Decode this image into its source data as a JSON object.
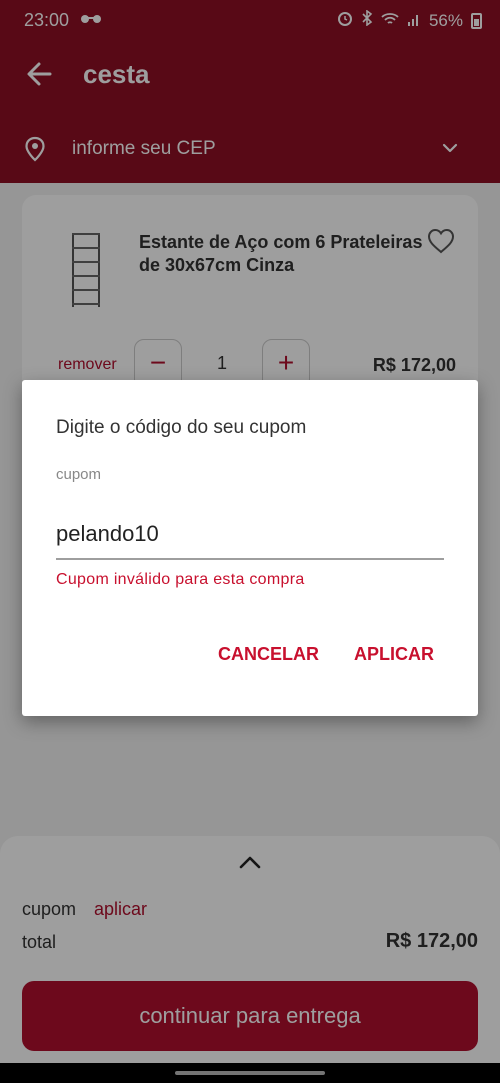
{
  "status_bar": {
    "time": "23:00",
    "glasses_icon": "glasses-icon",
    "icons": [
      "alarm-icon",
      "bluetooth-icon",
      "wifi-icon",
      "signal-icon"
    ],
    "battery": "56%",
    "battery_level": 0.56
  },
  "header": {
    "title": "cesta",
    "location_placeholder": "informe seu CEP",
    "icons": [
      "back-arrow-icon",
      "location-pin-icon",
      "chevron-down-icon"
    ]
  },
  "cart_item": {
    "name": "Estante de Aço com 6 Prateleiras de 30x67cm Cinza",
    "remove_label": "remover",
    "qty_minus": "−",
    "quantity": "1",
    "qty_plus": "+",
    "price": "R$ 172,00",
    "icons": [
      "shelf-product-image",
      "heart-icon"
    ]
  },
  "summary": {
    "coupon_label": "cupom",
    "coupon_action": "aplicar",
    "total_label": "total",
    "total_value": "R$ 172,00",
    "continue_label": "continuar para entrega",
    "icons": [
      "chevron-up-icon"
    ]
  },
  "dialog": {
    "title": "Digite o código do seu cupom",
    "field_label": "cupom",
    "field_value": "pelando10",
    "error": "Cupom inválido para esta compra",
    "cancel_label": "CANCELAR",
    "apply_label": "APLICAR"
  },
  "colors": {
    "brand": "#8f0f24",
    "accent": "#b0102e",
    "error": "#c8102e"
  }
}
